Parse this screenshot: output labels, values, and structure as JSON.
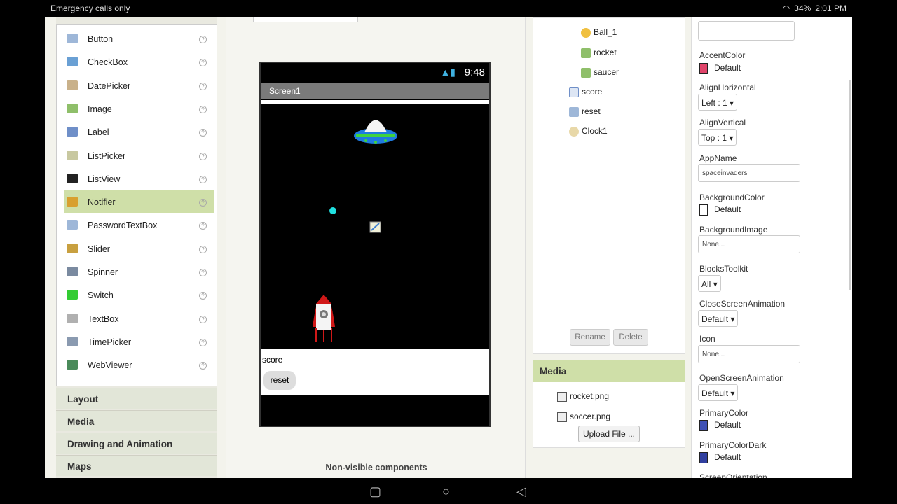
{
  "status": {
    "left": "Emergency calls only",
    "battery": "34%",
    "time": "2:01 PM"
  },
  "palette": {
    "items": [
      {
        "label": "Button",
        "icon": "button-icon",
        "color": "#9eb7d8"
      },
      {
        "label": "CheckBox",
        "icon": "checkbox-icon",
        "color": "#6aa0d4"
      },
      {
        "label": "DatePicker",
        "icon": "datepicker-icon",
        "color": "#c9b18a"
      },
      {
        "label": "Image",
        "icon": "image-icon",
        "color": "#8fbf6a"
      },
      {
        "label": "Label",
        "icon": "label-icon",
        "color": "#6f8fc8"
      },
      {
        "label": "ListPicker",
        "icon": "listpicker-icon",
        "color": "#c8c8a0"
      },
      {
        "label": "ListView",
        "icon": "listview-icon",
        "color": "#222222"
      },
      {
        "label": "Notifier",
        "icon": "notifier-icon",
        "color": "#d8a030"
      },
      {
        "label": "PasswordTextBox",
        "icon": "password-icon",
        "color": "#9eb7d8"
      },
      {
        "label": "Slider",
        "icon": "slider-icon",
        "color": "#c8a040"
      },
      {
        "label": "Spinner",
        "icon": "spinner-icon",
        "color": "#7a8aa0"
      },
      {
        "label": "Switch",
        "icon": "switch-icon",
        "color": "#33cc33"
      },
      {
        "label": "TextBox",
        "icon": "textbox-icon",
        "color": "#b0b0b0"
      },
      {
        "label": "TimePicker",
        "icon": "timepicker-icon",
        "color": "#8a9ab0"
      },
      {
        "label": "WebViewer",
        "icon": "webviewer-icon",
        "color": "#4a8a5a"
      }
    ],
    "help": "?",
    "categories": [
      "Layout",
      "Media",
      "Drawing and Animation",
      "Maps"
    ]
  },
  "viewer": {
    "phone_time": "9:48",
    "screen_title": "Screen1",
    "score_label": "score",
    "reset_label": "reset",
    "nonvisible": "Non-visible components"
  },
  "components": {
    "items": [
      "Ball_1",
      "rocket",
      "saucer",
      "score",
      "reset",
      "Clock1"
    ],
    "rename": "Rename",
    "delete": "Delete"
  },
  "media": {
    "title": "Media",
    "files": [
      "rocket.png",
      "soccer.png"
    ],
    "upload": "Upload File ..."
  },
  "props": {
    "accent_label": "AccentColor",
    "accent_value": "Default",
    "accent_color": "#e0446a",
    "alignh_label": "AlignHorizontal",
    "alignh_value": "Left : 1",
    "alignv_label": "AlignVertical",
    "alignv_value": "Top : 1",
    "appname_label": "AppName",
    "appname_value": "spaceinvaders",
    "bgcolor_label": "BackgroundColor",
    "bgcolor_value": "Default",
    "bgimage_label": "BackgroundImage",
    "bgimage_value": "None...",
    "blocks_label": "BlocksToolkit",
    "blocks_value": "All",
    "close_label": "CloseScreenAnimation",
    "close_value": "Default",
    "icon_label": "Icon",
    "icon_value": "None...",
    "open_label": "OpenScreenAnimation",
    "open_value": "Default",
    "primary_label": "PrimaryColor",
    "primary_value": "Default",
    "primary_color": "#3f51b5",
    "primarydark_label": "PrimaryColorDark",
    "primarydark_value": "Default",
    "primarydark_color": "#303f9f",
    "orientation_label": "ScreenOrientation"
  }
}
